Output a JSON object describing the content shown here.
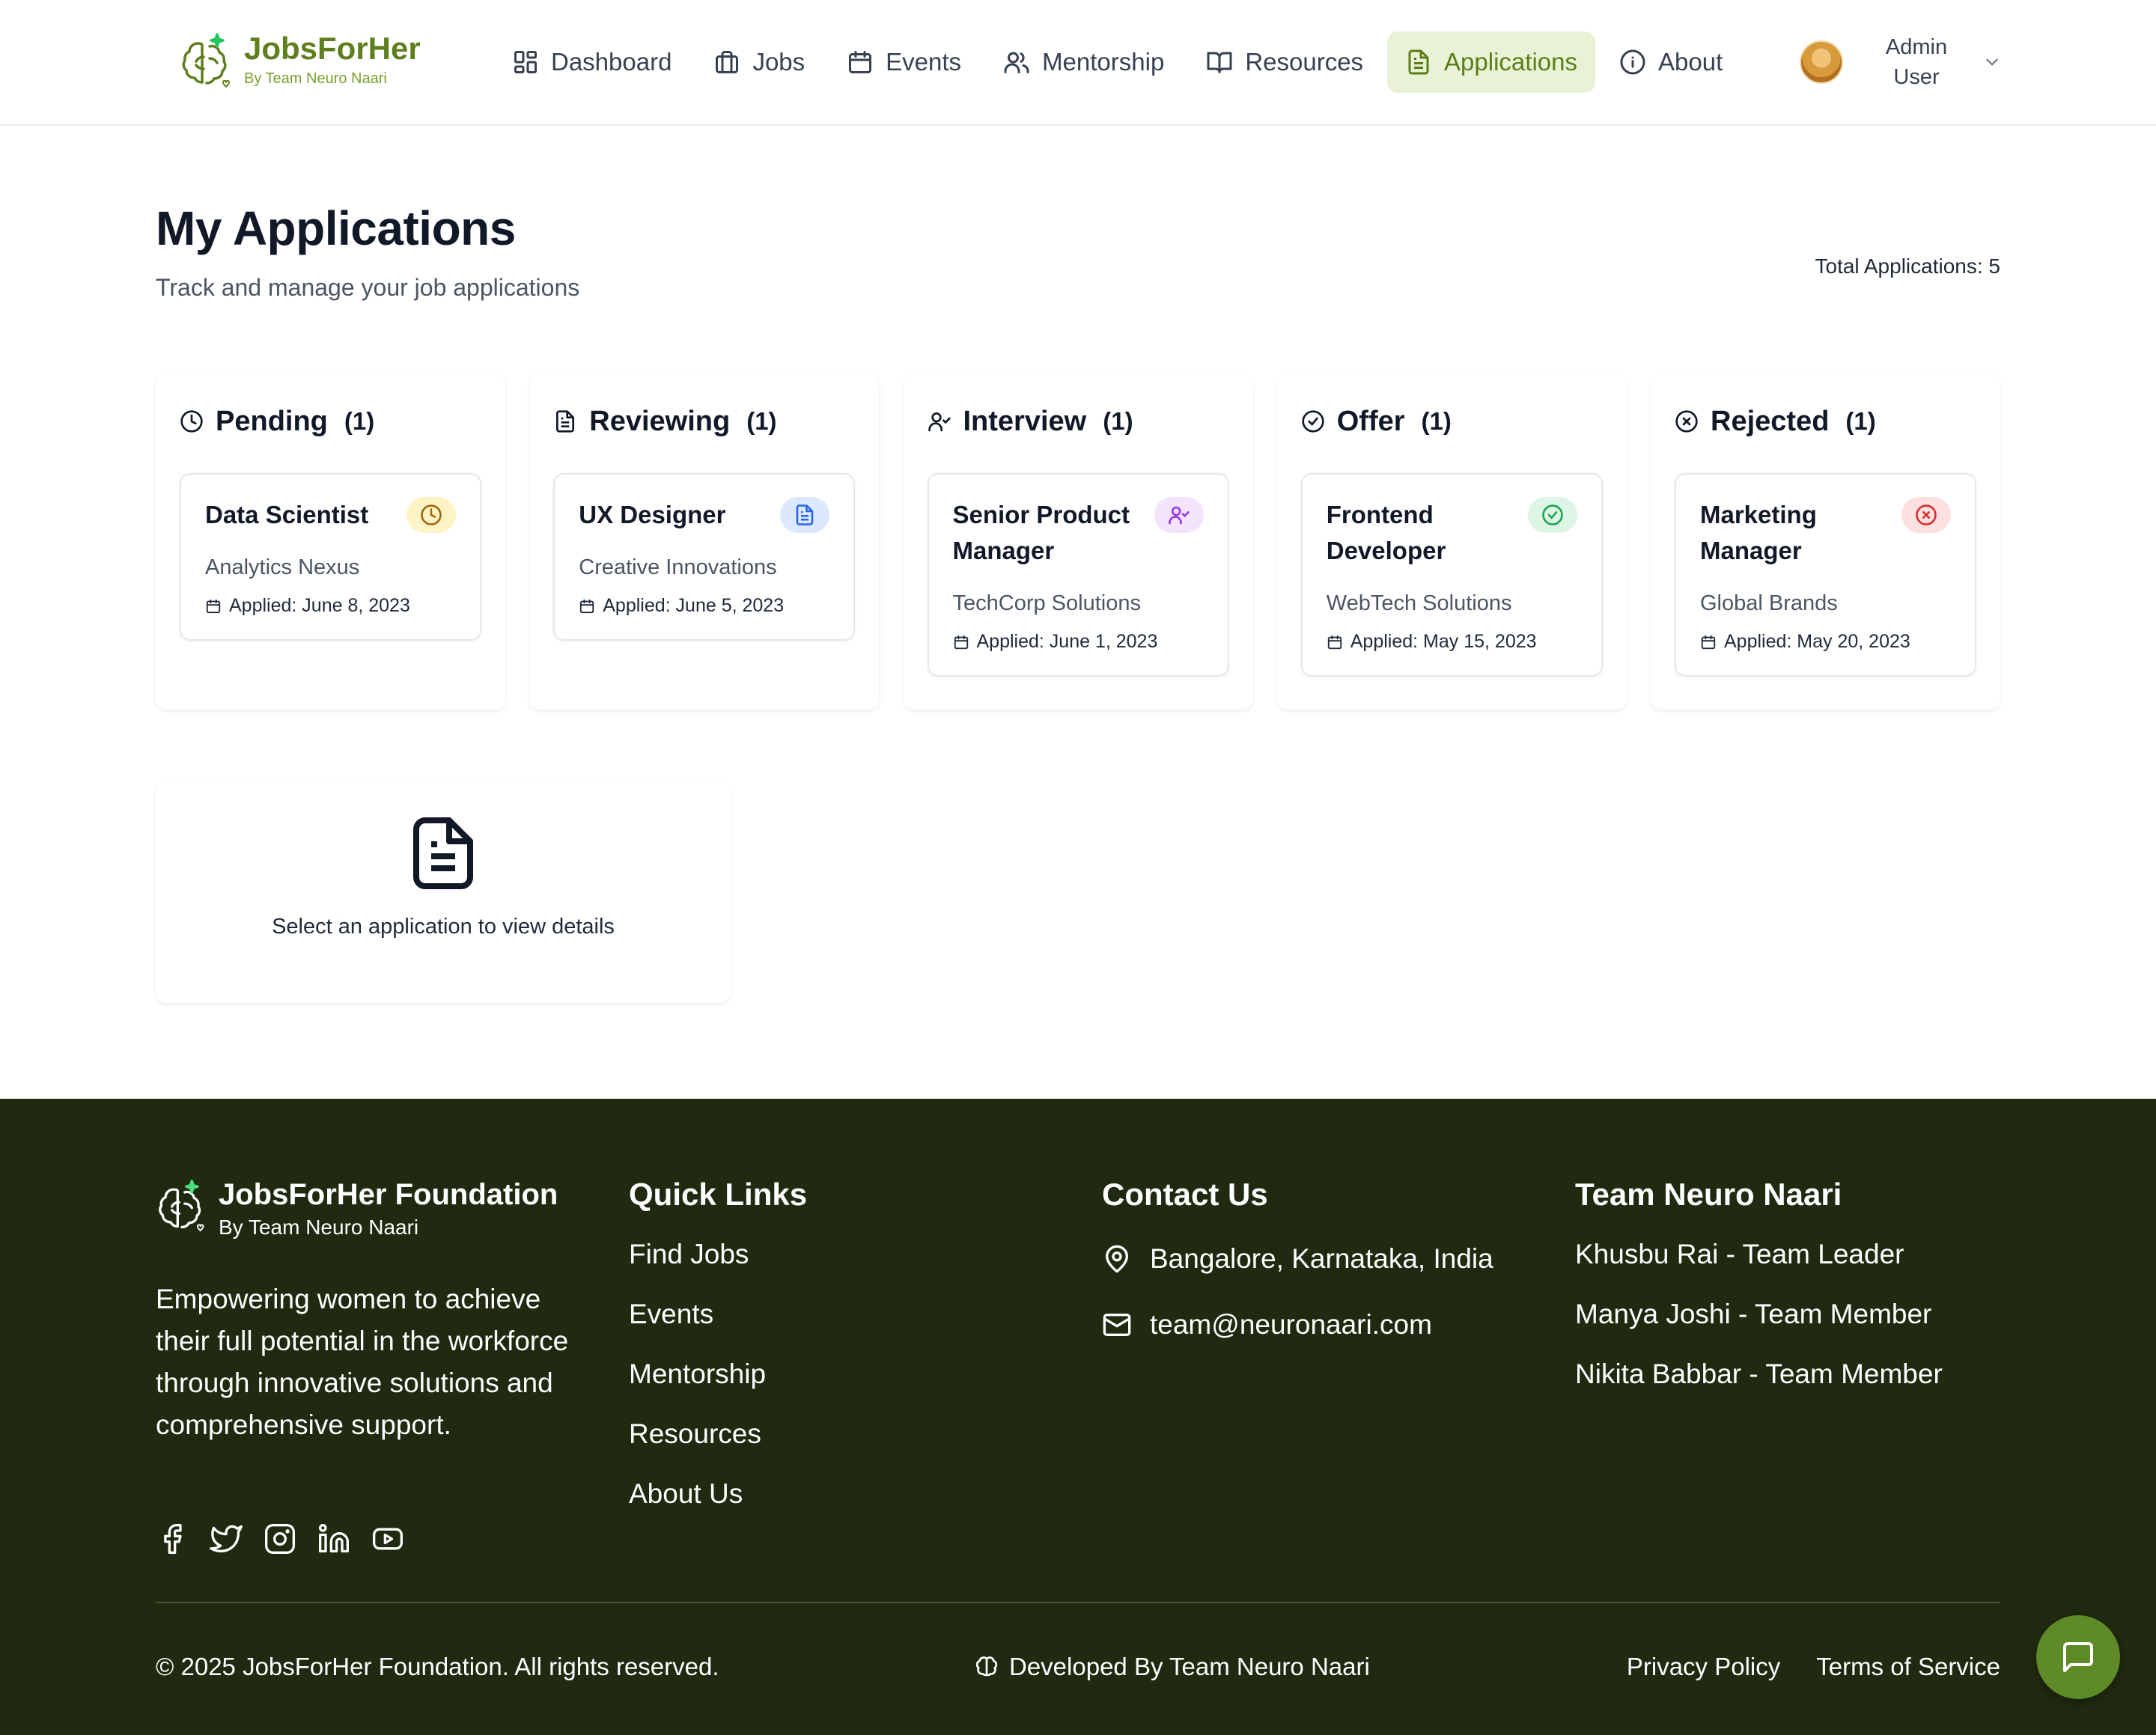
{
  "brand": {
    "name": "JobsForHer",
    "tagline": "By Team Neuro Naari",
    "color": "#5f7f1e"
  },
  "nav": {
    "items": [
      {
        "label": "Dashboard",
        "icon": "dashboard-icon"
      },
      {
        "label": "Jobs",
        "icon": "briefcase-icon"
      },
      {
        "label": "Events",
        "icon": "calendar-icon"
      },
      {
        "label": "Mentorship",
        "icon": "users-icon"
      },
      {
        "label": "Resources",
        "icon": "book-icon"
      },
      {
        "label": "Applications",
        "icon": "document-icon",
        "active": true
      },
      {
        "label": "About",
        "icon": "info-icon"
      }
    ],
    "user": {
      "line1": "Admin",
      "line2": "User"
    }
  },
  "page": {
    "title": "My Applications",
    "subtitle": "Track and manage your job applications",
    "total": "Total Applications: 5"
  },
  "board": {
    "columns": [
      {
        "title": "Pending",
        "count": "(1)",
        "icon": "clock-icon",
        "badge_color": "#fdf3c4",
        "icon_color": "#a16207",
        "card": {
          "title": "Data Scientist",
          "company": "Analytics Nexus",
          "applied": "Applied: June 8, 2023"
        }
      },
      {
        "title": "Reviewing",
        "count": "(1)",
        "icon": "document-icon",
        "badge_color": "#dbe8fd",
        "icon_color": "#2563eb",
        "card": {
          "title": "UX Designer",
          "company": "Creative Innovations",
          "applied": "Applied: June 5, 2023"
        }
      },
      {
        "title": "Interview",
        "count": "(1)",
        "icon": "user-check-icon",
        "badge_color": "#f3e3fb",
        "icon_color": "#9333ea",
        "card": {
          "title": "Senior Product Manager",
          "company": "TechCorp Solutions",
          "applied": "Applied: June 1, 2023"
        }
      },
      {
        "title": "Offer",
        "count": "(1)",
        "icon": "check-circle-icon",
        "badge_color": "#dcf5e4",
        "icon_color": "#16a34a",
        "card": {
          "title": "Frontend Developer",
          "company": "WebTech Solutions",
          "applied": "Applied: May 15, 2023"
        }
      },
      {
        "title": "Rejected",
        "count": "(1)",
        "icon": "x-circle-icon",
        "badge_color": "#fde0e0",
        "icon_color": "#dc2626",
        "card": {
          "title": "Marketing Manager",
          "company": "Global Brands",
          "applied": "Applied: May 20, 2023"
        }
      }
    ]
  },
  "details": {
    "placeholder": "Select an application to view details"
  },
  "footer": {
    "brand": {
      "name": "JobsForHer Foundation",
      "tagline": "By Team Neuro Naari"
    },
    "description": "Empowering women to achieve their full potential in the workforce through innovative solutions and comprehensive support.",
    "socials": [
      "facebook-icon",
      "twitter-icon",
      "instagram-icon",
      "linkedin-icon",
      "youtube-icon"
    ],
    "quick_links": {
      "heading": "Quick Links",
      "items": [
        "Find Jobs",
        "Events",
        "Mentorship",
        "Resources",
        "About Us"
      ]
    },
    "contact": {
      "heading": "Contact Us",
      "location": "Bangalore, Karnataka, India",
      "email": "team@neuronaari.com"
    },
    "team": {
      "heading": "Team Neuro Naari",
      "members": [
        "Khusbu Rai - Team Leader",
        "Manya Joshi - Team Member",
        "Nikita Babbar - Team Member"
      ]
    },
    "copyright": "© 2025 JobsForHer Foundation. All rights reserved.",
    "developed_by": "Developed By Team Neuro Naari",
    "privacy": "Privacy Policy",
    "terms": "Terms of Service",
    "bg_color": "#1f2a10"
  },
  "chat": {
    "icon": "chat-icon",
    "color": "#5e8a27"
  }
}
